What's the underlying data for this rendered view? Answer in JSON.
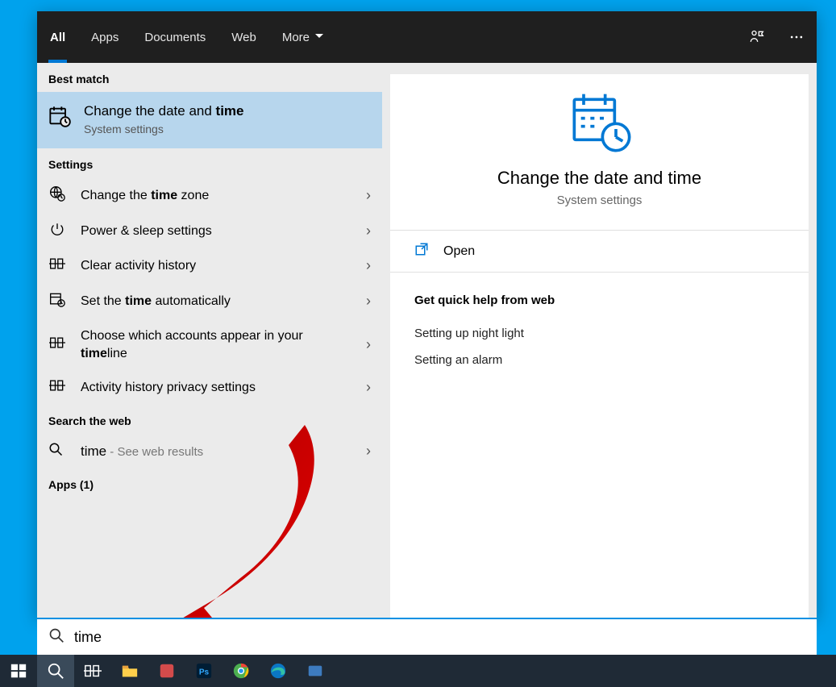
{
  "tabs": {
    "all": "All",
    "apps": "Apps",
    "documents": "Documents",
    "web": "Web",
    "more": "More"
  },
  "sections": {
    "best_match": "Best match",
    "settings": "Settings",
    "search_web": "Search the web",
    "apps_count": "Apps (1)"
  },
  "best_match_item": {
    "title_pre": "Change the date and ",
    "title_bold": "time",
    "subtitle": "System settings"
  },
  "settings_items": [
    {
      "pre": "Change the ",
      "bold": "time",
      "post": " zone",
      "icon": "globe-clock"
    },
    {
      "pre": "Power & sleep settings",
      "bold": "",
      "post": "",
      "icon": "power"
    },
    {
      "pre": "Clear activity history",
      "bold": "",
      "post": "",
      "icon": "timeline"
    },
    {
      "pre": "Set the ",
      "bold": "time",
      "post": " automatically",
      "icon": "calendar-clock"
    },
    {
      "pre": "Choose which accounts appear in your ",
      "bold": "time",
      "post": "line",
      "icon": "timeline"
    },
    {
      "pre": "Activity history privacy settings",
      "bold": "",
      "post": "",
      "icon": "timeline"
    }
  ],
  "web_item": {
    "label": "time",
    "sub": " - See web results"
  },
  "detail": {
    "title": "Change the date and time",
    "subtitle": "System settings",
    "open": "Open",
    "help_heading": "Get quick help from web",
    "help_links": [
      "Setting up night light",
      "Setting an alarm"
    ]
  },
  "search": {
    "value": "time"
  },
  "colors": {
    "accent": "#0078d4"
  }
}
